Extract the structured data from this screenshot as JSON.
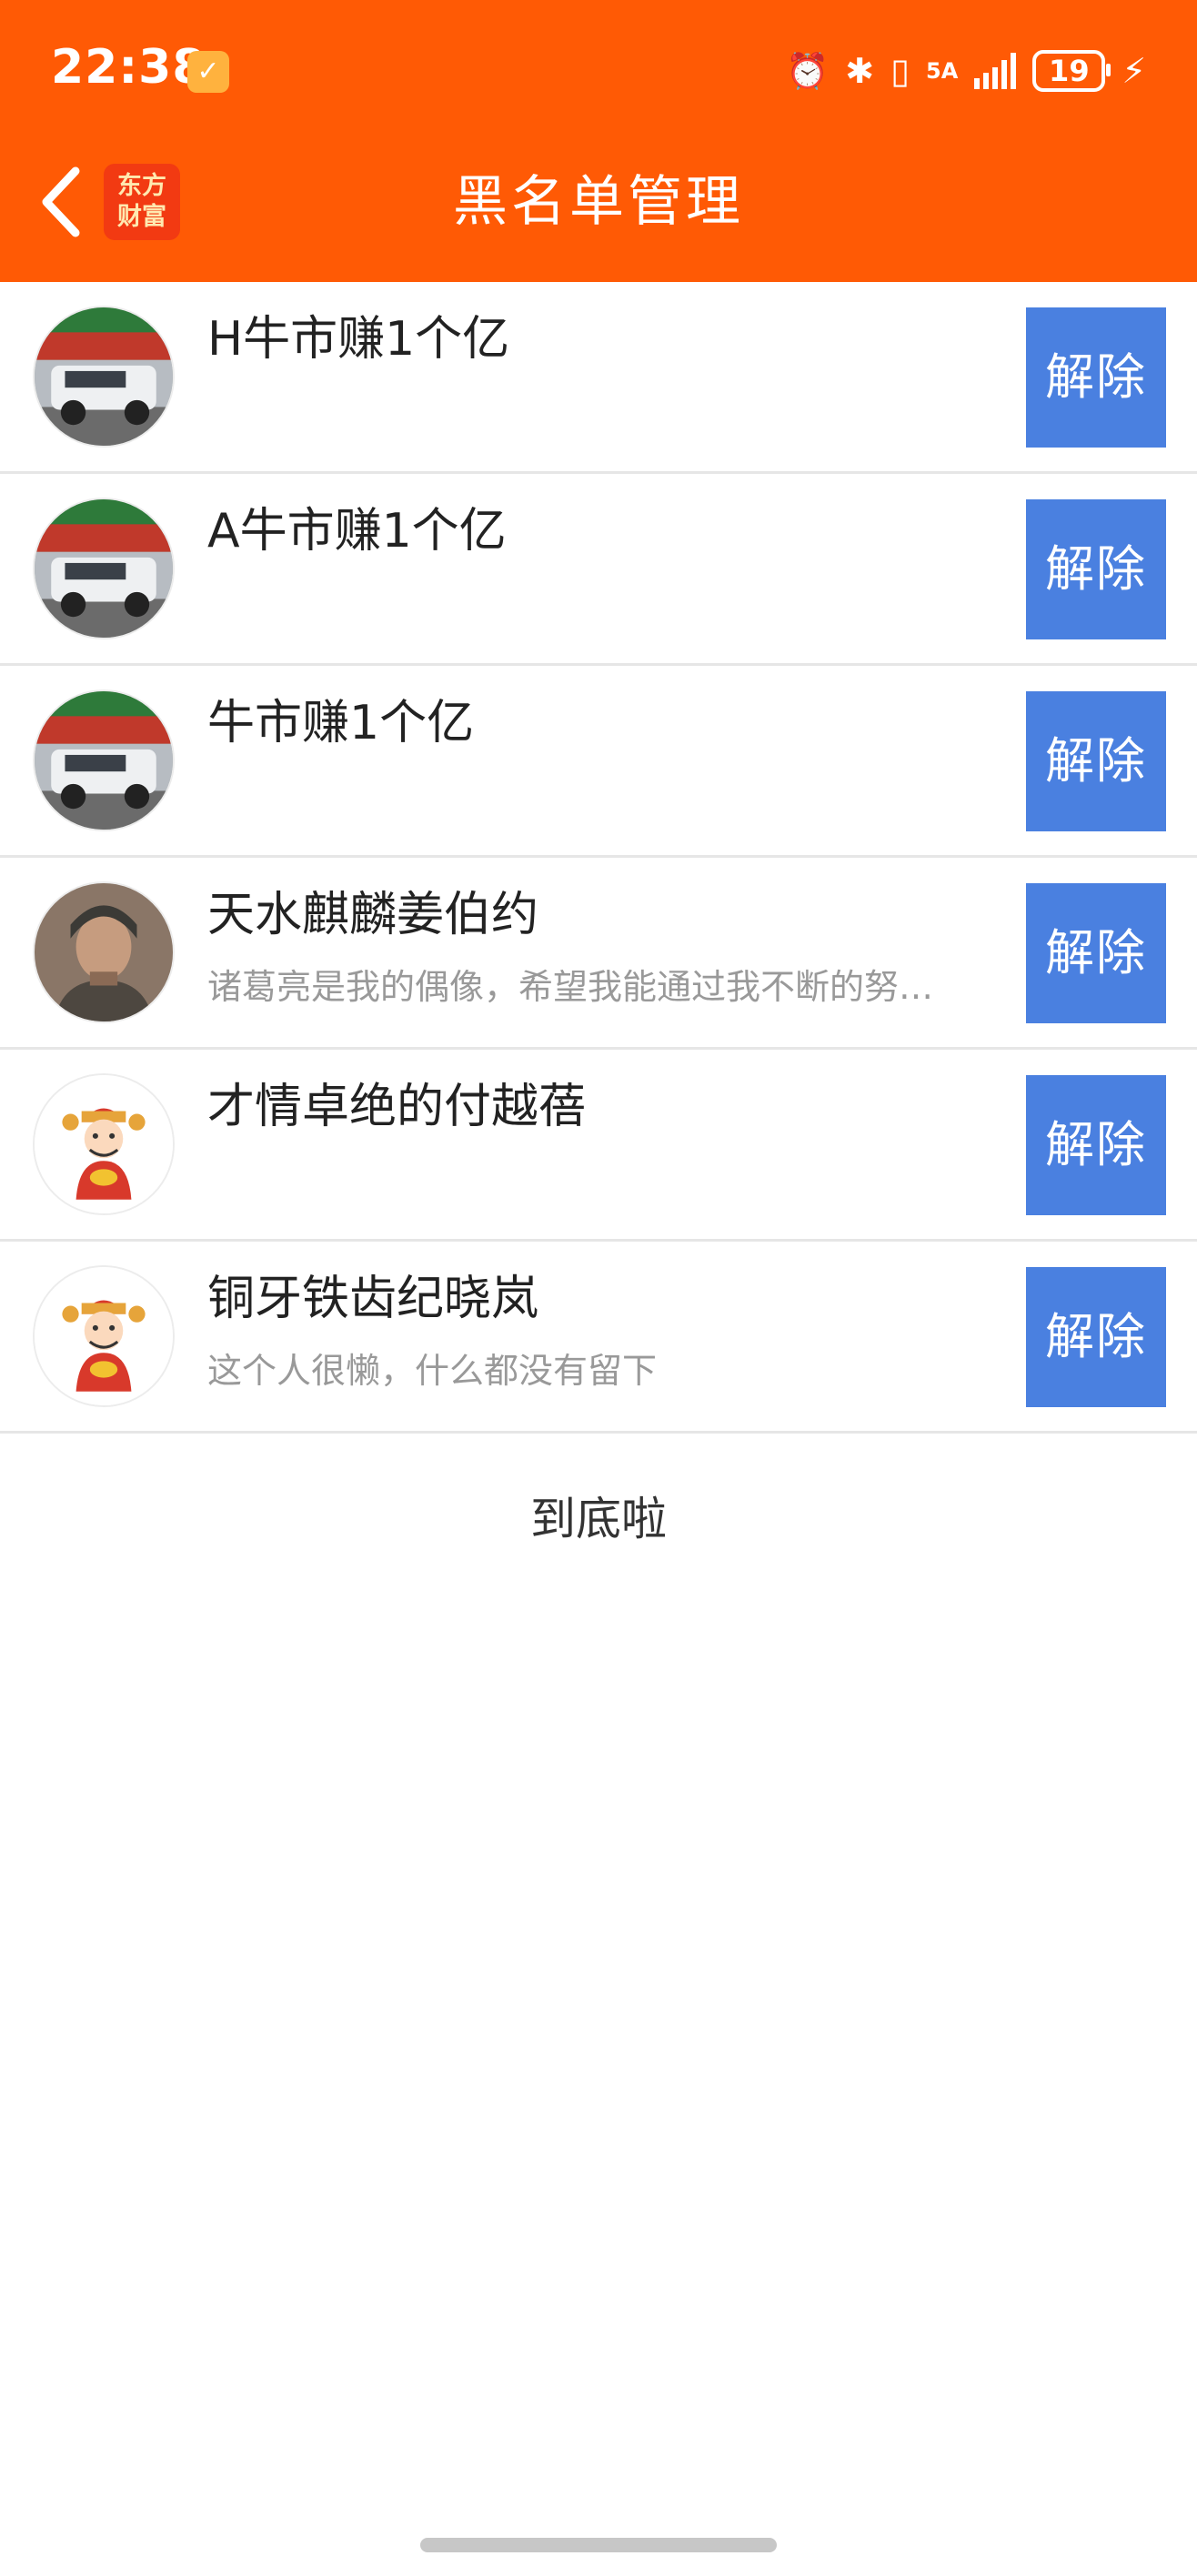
{
  "status_bar": {
    "time": "22:38",
    "app_badge": "✓",
    "network_label": "5A",
    "battery": "19"
  },
  "header": {
    "back_icon": "chevron-left-icon",
    "logo_line1": "东方",
    "logo_line2": "财富",
    "title": "黑名单管理",
    "accent_color": "#ff5a05"
  },
  "blacklist": [
    {
      "name": "H牛市赚1个亿",
      "signature": "",
      "avatar": "suv-photo"
    },
    {
      "name": "A牛市赚1个亿",
      "signature": "",
      "avatar": "suv-photo"
    },
    {
      "name": "牛市赚1个亿",
      "signature": "",
      "avatar": "suv-photo"
    },
    {
      "name": "天水麒麟姜伯约",
      "signature": "诸葛亮是我的偶像，希望我能通过我不断的努…",
      "avatar": "warrior-photo"
    },
    {
      "name": "才情卓绝的付越蓓",
      "signature": "",
      "avatar": "fortune-god-cartoon"
    },
    {
      "name": "铜牙铁齿纪晓岚",
      "signature": "这个人很懒，什么都没有留下",
      "avatar": "fortune-god-cartoon"
    }
  ],
  "remove_label": "解除",
  "button_color": "#4a80e0",
  "end_text": "到底啦"
}
